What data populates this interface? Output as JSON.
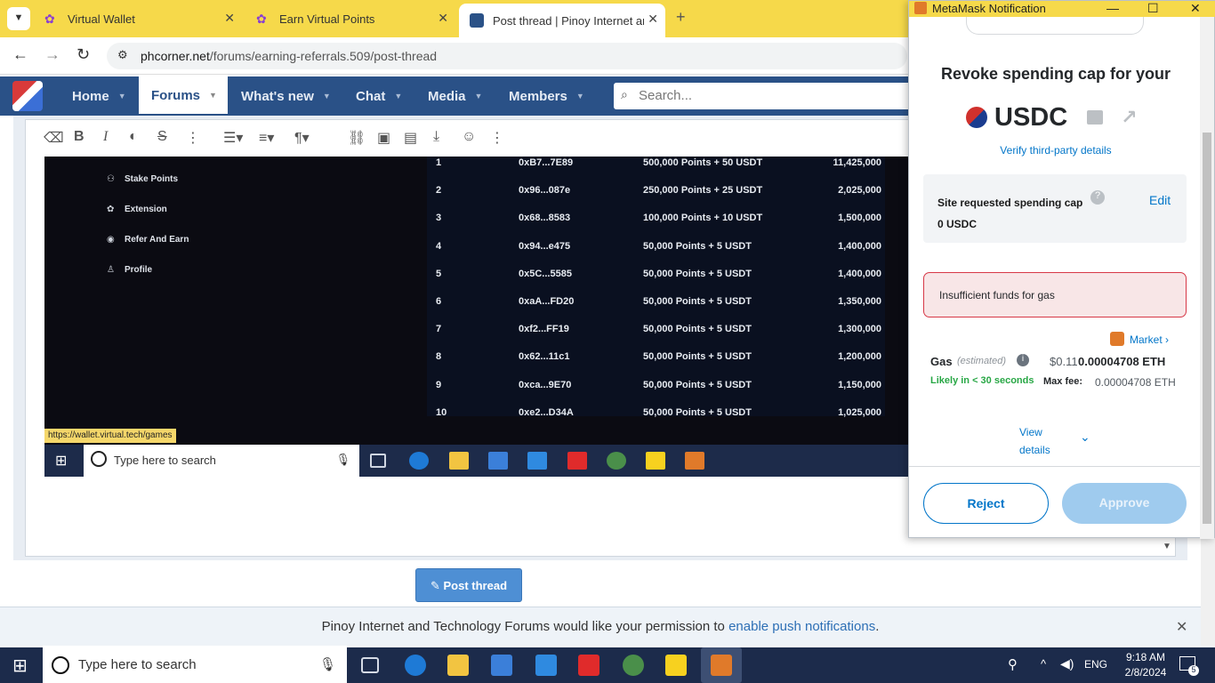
{
  "browser": {
    "tabs": [
      {
        "label": "Virtual Wallet"
      },
      {
        "label": "Earn Virtual Points"
      },
      {
        "label": "Post thread | Pinoy Internet and"
      }
    ],
    "url_host": "phcorner.net",
    "url_path": "/forums/earning-referrals.509/post-thread"
  },
  "forum": {
    "nav": [
      "Home",
      "Forums",
      "What's new",
      "Chat",
      "Media",
      "Members"
    ],
    "search_placeholder": "Search...",
    "post_button": "Post thread",
    "push_text": "Pinoy Internet and Technology Forums would like your permission to",
    "push_link": "enable push notifications",
    "push_end": "."
  },
  "embedded": {
    "menu": [
      "Stake Points",
      "Extension",
      "Refer And Earn",
      "Profile"
    ],
    "rows": [
      {
        "rank": "1",
        "addr": "0xB7...7E89",
        "reward": "500,000 Points + 50 USDT",
        "points": "11,425,000"
      },
      {
        "rank": "2",
        "addr": "0x96...087e",
        "reward": "250,000 Points + 25 USDT",
        "points": "2,025,000"
      },
      {
        "rank": "3",
        "addr": "0x68...8583",
        "reward": "100,000 Points + 10 USDT",
        "points": "1,500,000"
      },
      {
        "rank": "4",
        "addr": "0x94...e475",
        "reward": "50,000 Points + 5 USDT",
        "points": "1,400,000"
      },
      {
        "rank": "5",
        "addr": "0x5C...5585",
        "reward": "50,000 Points + 5 USDT",
        "points": "1,400,000"
      },
      {
        "rank": "6",
        "addr": "0xaA...FD20",
        "reward": "50,000 Points + 5 USDT",
        "points": "1,350,000"
      },
      {
        "rank": "7",
        "addr": "0xf2...FF19",
        "reward": "50,000 Points + 5 USDT",
        "points": "1,300,000"
      },
      {
        "rank": "8",
        "addr": "0x62...11c1",
        "reward": "50,000 Points + 5 USDT",
        "points": "1,200,000"
      },
      {
        "rank": "9",
        "addr": "0xca...9E70",
        "reward": "50,000 Points + 5 USDT",
        "points": "1,150,000"
      },
      {
        "rank": "10",
        "addr": "0xe2...D34A",
        "reward": "50,000 Points + 5 USDT",
        "points": "1,025,000"
      }
    ],
    "tooltip": "https://wallet.virtual.tech/games",
    "search_placeholder": "Type here to search"
  },
  "metamask": {
    "window_title": "MetaMask Notification",
    "heading": "Revoke spending cap for your",
    "token": "USDC",
    "verify": "Verify third-party details",
    "cap_label": "Site requested spending cap",
    "cap_value": "0 USDC",
    "edit": "Edit",
    "error": "Insufficient funds for gas",
    "market": "Market",
    "gas_label": "Gas",
    "gas_estimated": "(estimated)",
    "gas_usd": "$0.11",
    "gas_eth": "0.00004708 ETH",
    "likely": "Likely in < 30 seconds",
    "maxfee_label": "Max fee:",
    "maxfee_value": "0.00004708 ETH",
    "view": "View",
    "details": "details",
    "reject": "Reject",
    "approve": "Approve"
  },
  "taskbar": {
    "search_placeholder": "Type here to search",
    "lang": "ENG",
    "time": "9:18 AM",
    "date": "2/8/2024",
    "notif_count": "5"
  },
  "colors": {
    "accent_blue": "#2a5187",
    "metamask_blue": "#0376c9",
    "tab_yellow": "#f6d94a",
    "error_red": "#d73847"
  }
}
